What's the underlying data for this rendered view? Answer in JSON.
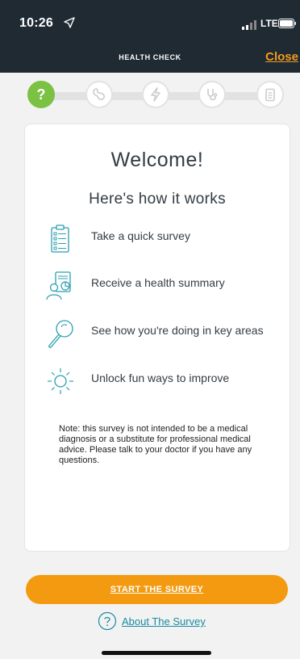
{
  "status_bar": {
    "time": "10:26",
    "network": "LTE"
  },
  "header": {
    "title": "HEALTH CHECK",
    "close_label": "Close"
  },
  "stepper": {
    "steps": [
      {
        "icon": "question-icon",
        "label": "?",
        "active": true
      },
      {
        "icon": "digestion-icon",
        "active": false
      },
      {
        "icon": "energy-icon",
        "active": false
      },
      {
        "icon": "stethoscope-icon",
        "active": false
      },
      {
        "icon": "clipboard-icon",
        "active": false
      }
    ]
  },
  "card": {
    "welcome": "Welcome!",
    "subtitle": "Here's how it works",
    "features": [
      {
        "icon": "survey-list-icon",
        "label": "Take a quick survey"
      },
      {
        "icon": "health-summary-icon",
        "label": "Receive a health summary"
      },
      {
        "icon": "magnifier-icon",
        "label": "See how you're doing in key areas"
      },
      {
        "icon": "lightbulb-sun-icon",
        "label": "Unlock fun ways to improve"
      }
    ],
    "note": "Note: this survey is not intended to be a medical diagnosis or a substitute for professional medical advice. Please talk to your doctor if you have any questions."
  },
  "actions": {
    "start_label": "START THE SURVEY",
    "about_label": "About The Survey"
  },
  "colors": {
    "header_bg": "#1f2a33",
    "accent_orange": "#f39a10",
    "active_step": "#7bc144",
    "link_teal": "#1a8ba0",
    "icon_teal": "#2a9fb0"
  }
}
